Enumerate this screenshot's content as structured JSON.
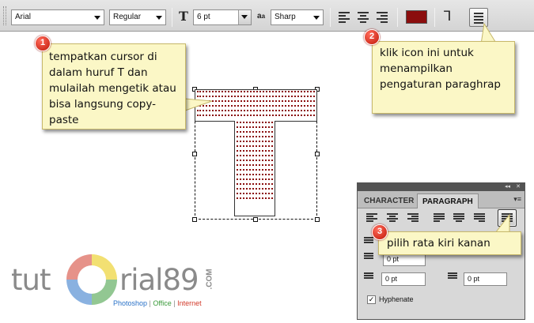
{
  "toolbar": {
    "font_family": "Arial",
    "font_style": "Regular",
    "font_size": "6 pt",
    "aa_label": "a",
    "antialias": "Sharp",
    "text_color": "#8b0e0e",
    "size_icon_glyph": "T",
    "warp_icon_glyph": "Ꞁ"
  },
  "callouts": [
    {
      "badge": "1",
      "text": "tempatkan cursor di dalam huruf T dan mulailah mengetik atau bisa langsung copy-paste"
    },
    {
      "badge": "2",
      "text": "klik icon ini untuk menampilkan pengaturan paraghrap"
    },
    {
      "badge": "3",
      "text": "pilih rata kiri kanan"
    }
  ],
  "panel": {
    "tabs": [
      "CHARACTER",
      "PARAGRAPH"
    ],
    "active_tab": "PARAGRAPH",
    "indent_left": "0 pt",
    "indent_right": "0 pt",
    "space_before": "0 pt",
    "space_after": "0 pt",
    "hyphenate_label": "Hyphenate",
    "hyphenate_checked": true
  },
  "watermark": {
    "text_left": "tut",
    "text_right": "rial89",
    "com": ".COM",
    "sub_photoshop": "Photoshop",
    "sub_sep1": " | ",
    "sub_office": "Office",
    "sub_sep2": " | ",
    "sub_internet": "Internet",
    "colors": {
      "photoshop": "#2a72c8",
      "office": "#3a9a3a",
      "internet": "#d23a2a"
    }
  }
}
